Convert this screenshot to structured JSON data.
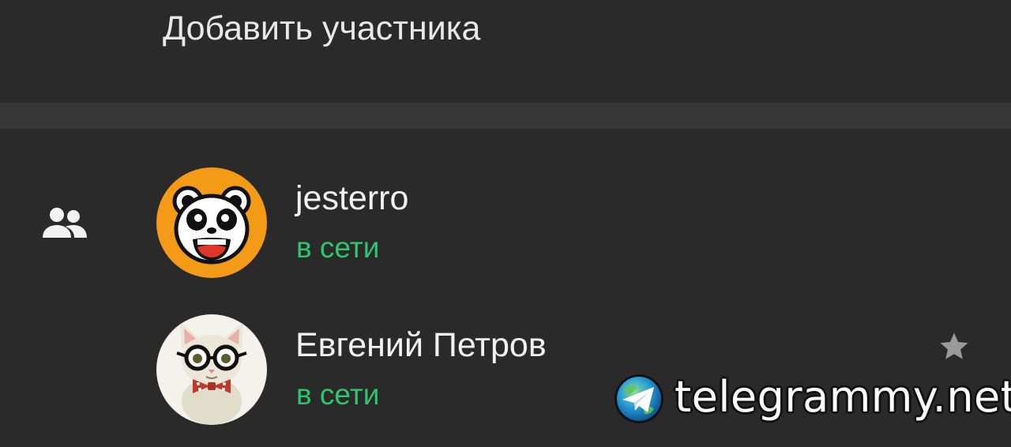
{
  "header": {
    "add_member_label": "Добавить участника"
  },
  "members": [
    {
      "name": "jesterro",
      "status": "в сети",
      "avatar": "panda-avatar",
      "starred": false
    },
    {
      "name": "Евгений Петров",
      "status": "в сети",
      "avatar": "cat-glasses-avatar",
      "starred": true
    }
  ],
  "icons": {
    "members": "group-icon",
    "star": "star-icon",
    "watermark_logo": "telegram-globe-icon"
  },
  "colors": {
    "background": "#2a2a2a",
    "divider": "#373737",
    "online_status": "#2fc46d",
    "text_primary": "#f2f2f2",
    "star": "#9a9a9a"
  },
  "watermark": {
    "text": "telegrammy.net"
  }
}
